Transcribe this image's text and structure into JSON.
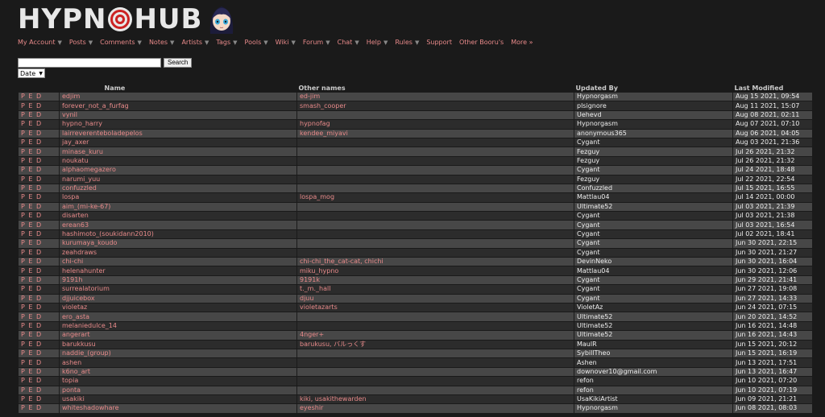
{
  "logo": {
    "text_left": "HYPN",
    "text_right": "HUB"
  },
  "nav": [
    {
      "label": "My Account",
      "arrow": true
    },
    {
      "label": "Posts",
      "arrow": true
    },
    {
      "label": "Comments",
      "arrow": true
    },
    {
      "label": "Notes",
      "arrow": true
    },
    {
      "label": "Artists",
      "arrow": true
    },
    {
      "label": "Tags",
      "arrow": true
    },
    {
      "label": "Pools",
      "arrow": true
    },
    {
      "label": "Wiki",
      "arrow": true
    },
    {
      "label": "Forum",
      "arrow": true
    },
    {
      "label": "Chat",
      "arrow": true
    },
    {
      "label": "Help",
      "arrow": true
    },
    {
      "label": "Rules",
      "arrow": true
    },
    {
      "label": "Support",
      "arrow": false
    },
    {
      "label": "Other Booru's",
      "arrow": false
    },
    {
      "label": "More »",
      "arrow": false
    }
  ],
  "search": {
    "value": "",
    "button": "Search"
  },
  "sort": {
    "selected": "Date"
  },
  "table": {
    "headers": {
      "actions": "",
      "name": "Name",
      "other": "Other names",
      "updated": "Updated By",
      "modified": "Last Modified"
    },
    "rows": [
      {
        "a": "P E D",
        "name": "edjim",
        "other": "ed-jim",
        "by": "Hypnorgasm",
        "date": "Aug 15 2021, 09:54"
      },
      {
        "a": "P E D",
        "name": "forever_not_a_furfag",
        "other": "smash_cooper",
        "by": "plsignore",
        "date": "Aug 11 2021, 15:07"
      },
      {
        "a": "P E D",
        "name": "vynil",
        "other": "",
        "by": "Uehevd",
        "date": "Aug 08 2021, 02:11"
      },
      {
        "a": "P E D",
        "name": "hypno_harry",
        "other": "hypnofag",
        "by": "Hypnorgasm",
        "date": "Aug 07 2021, 07:10"
      },
      {
        "a": "P E D",
        "name": "lairreverenteboladepelos",
        "other": "kendee_miyavi",
        "by": "anonymous365",
        "date": "Aug 06 2021, 04:05"
      },
      {
        "a": "P E D",
        "name": "jay_axer",
        "other": "",
        "by": "Cygant",
        "date": "Aug 03 2021, 21:36"
      },
      {
        "a": "P E D",
        "name": "minase_kuru",
        "other": "",
        "by": "Fezguy",
        "date": "Jul 26 2021, 21:32"
      },
      {
        "a": "P E D",
        "name": "noukatu",
        "other": "",
        "by": "Fezguy",
        "date": "Jul 26 2021, 21:32"
      },
      {
        "a": "P E D",
        "name": "alphaomegazero",
        "other": "",
        "by": "Cygant",
        "date": "Jul 24 2021, 18:48"
      },
      {
        "a": "P E D",
        "name": "narumi_yuu",
        "other": "",
        "by": "Fezguy",
        "date": "Jul 22 2021, 22:54"
      },
      {
        "a": "P E D",
        "name": "confuzzled",
        "other": "",
        "by": "Confuzzled",
        "date": "Jul 15 2021, 16:55"
      },
      {
        "a": "P E D",
        "name": "lospa",
        "other": "lospa_mog",
        "by": "Mattlau04",
        "date": "Jul 14 2021, 00:00"
      },
      {
        "a": "P E D",
        "name": "aim_(mi-ke-67)",
        "other": "",
        "by": "Ultimate52",
        "date": "Jul 03 2021, 21:39"
      },
      {
        "a": "P E D",
        "name": "disarten",
        "other": "",
        "by": "Cygant",
        "date": "Jul 03 2021, 21:38"
      },
      {
        "a": "P E D",
        "name": "erean63",
        "other": "",
        "by": "Cygant",
        "date": "Jul 03 2021, 16:54"
      },
      {
        "a": "P E D",
        "name": "hashimoto_(soukidann2010)",
        "other": "",
        "by": "Cygant",
        "date": "Jul 02 2021, 18:41"
      },
      {
        "a": "P E D",
        "name": "kurumaya_koudo",
        "other": "",
        "by": "Cygant",
        "date": "Jun 30 2021, 22:15"
      },
      {
        "a": "P E D",
        "name": "zeahdraws",
        "other": "",
        "by": "Cygant",
        "date": "Jun 30 2021, 21:27"
      },
      {
        "a": "P E D",
        "name": "chi-chi",
        "other": "chi-chi_the_cat-cat, chichi",
        "by": "DevinNeko",
        "date": "Jun 30 2021, 16:04"
      },
      {
        "a": "P E D",
        "name": "helenahunter",
        "other": "miku_hypno",
        "by": "Mattlau04",
        "date": "Jun 30 2021, 12:06"
      },
      {
        "a": "P E D",
        "name": "9191h",
        "other": "9191k",
        "by": "Cygant",
        "date": "Jun 29 2021, 21:41"
      },
      {
        "a": "P E D",
        "name": "surrealatorium",
        "other": "t._m._hall",
        "by": "Cygant",
        "date": "Jun 27 2021, 19:08"
      },
      {
        "a": "P E D",
        "name": "djjuicebox",
        "other": "djuu",
        "by": "Cygant",
        "date": "Jun 27 2021, 14:33"
      },
      {
        "a": "P E D",
        "name": "violetaz",
        "other": "violetazarts",
        "by": "VioletAz",
        "date": "Jun 24 2021, 07:15"
      },
      {
        "a": "P E D",
        "name": "ero_asta",
        "other": "",
        "by": "Ultimate52",
        "date": "Jun 20 2021, 14:52"
      },
      {
        "a": "P E D",
        "name": "melaniedulce_14",
        "other": "",
        "by": "Ultimate52",
        "date": "Jun 16 2021, 14:48"
      },
      {
        "a": "P E D",
        "name": "angerart",
        "other": "4nger+",
        "by": "Ultimate52",
        "date": "Jun 16 2021, 14:43"
      },
      {
        "a": "P E D",
        "name": "barukkusu",
        "other": "barukusu, バルっくす",
        "by": "MaulR",
        "date": "Jun 15 2021, 20:12"
      },
      {
        "a": "P E D",
        "name": "naddie_(group)",
        "other": "",
        "by": "SybillTheo",
        "date": "Jun 15 2021, 16:19"
      },
      {
        "a": "P E D",
        "name": "ashen",
        "other": "",
        "by": "Ashen",
        "date": "Jun 13 2021, 17:51"
      },
      {
        "a": "P E D",
        "name": "k6no_art",
        "other": "",
        "by": "downover10@gmail.com",
        "date": "Jun 13 2021, 16:47"
      },
      {
        "a": "P E D",
        "name": "topia",
        "other": "",
        "by": "refon",
        "date": "Jun 10 2021, 07:20"
      },
      {
        "a": "P E D",
        "name": "ponta",
        "other": "",
        "by": "refon",
        "date": "Jun 10 2021, 07:19"
      },
      {
        "a": "P E D",
        "name": "usakiki",
        "other": "kiki, usakithewarden",
        "by": "UsaKikiArtist",
        "date": "Jun 09 2021, 21:21"
      },
      {
        "a": "P E D",
        "name": "whiteshadowhare",
        "other": "eyeshir",
        "by": "Hypnorgasm",
        "date": "Jun 08 2021, 08:03"
      }
    ]
  }
}
